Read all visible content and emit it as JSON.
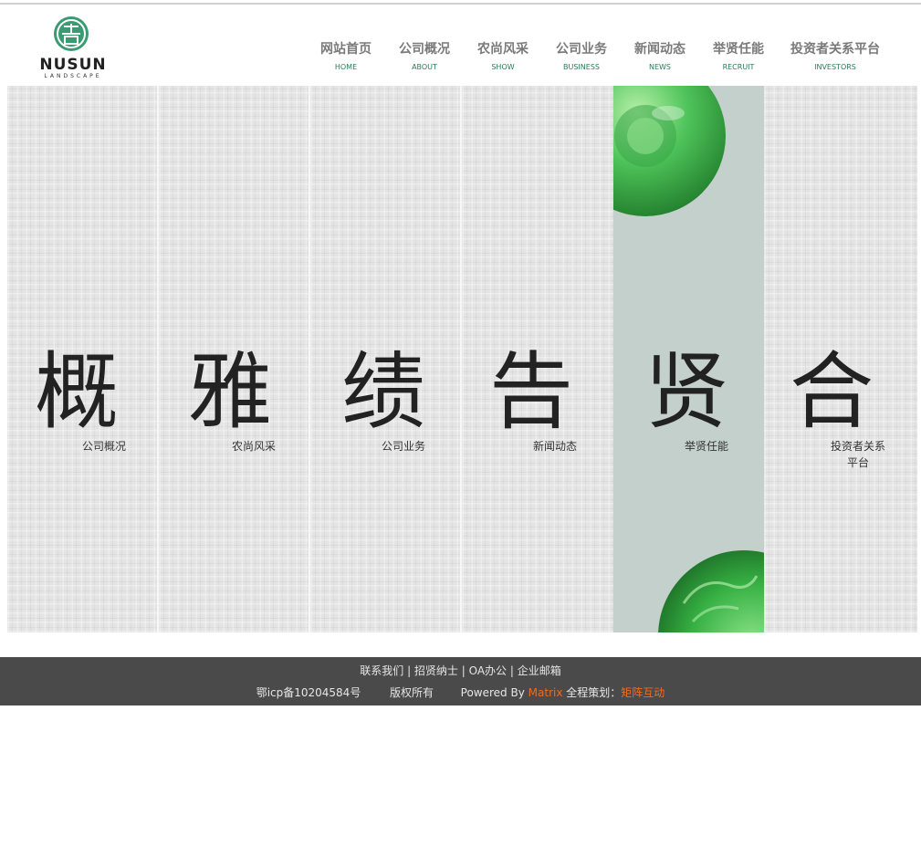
{
  "logo": {
    "brand": "NUSUN",
    "subtitle": "LANDSCAPE"
  },
  "nav": [
    {
      "zh": "网站首页",
      "en": "HOME"
    },
    {
      "zh": "公司概况",
      "en": "ABOUT"
    },
    {
      "zh": "农尚风采",
      "en": "SHOW"
    },
    {
      "zh": "公司业务",
      "en": "BUSINESS"
    },
    {
      "zh": "新闻动态",
      "en": "NEWS"
    },
    {
      "zh": "举贤任能",
      "en": "RECRUIT"
    },
    {
      "zh": "投资者关系平台",
      "en": "INVESTORS"
    }
  ],
  "panels": [
    {
      "char": "概",
      "caption": "公司概况"
    },
    {
      "char": "雅",
      "caption": "农尚风采"
    },
    {
      "char": "绩",
      "caption": "公司业务"
    },
    {
      "char": "告",
      "caption": "新闻动态"
    },
    {
      "char": "贤",
      "caption": "举贤任能"
    },
    {
      "char": "合",
      "caption": "投资者关系",
      "caption2": "平台"
    }
  ],
  "footer": {
    "links": [
      "联系我们",
      "招贤纳士",
      "OA办公",
      "企业邮箱"
    ],
    "icp": "鄂icp备10204584号",
    "rights": "版权所有",
    "powered": "Powered By",
    "matrix": "Matrix",
    "planning": "全程策划：",
    "agency": "矩阵互动"
  },
  "colors": {
    "accent_green": "#2a7b58",
    "footer_bg": "#4a4a4a",
    "highlight_orange": "#f26b1d",
    "active_panel": "#c3d0cb"
  }
}
